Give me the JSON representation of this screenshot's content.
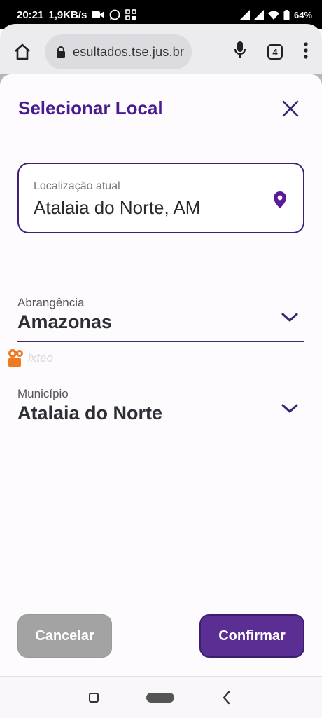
{
  "status_bar": {
    "time": "20:21",
    "speed": "1,9KB/s",
    "battery": "64%"
  },
  "browser": {
    "url": "esultados.tse.jus.br",
    "tab_count": "4",
    "icons": [
      "home-icon",
      "lock-icon",
      "mic-icon",
      "tabs-icon",
      "more-vert-icon"
    ]
  },
  "dialog": {
    "title": "Selecionar Local",
    "current_location": {
      "label": "Localização atual",
      "value": "Atalaia do Norte, AM"
    },
    "scope": {
      "label": "Abrangência",
      "value": "Amazonas"
    },
    "municipality": {
      "label": "Município",
      "value": "Atalaia do Norte"
    },
    "watermark": "ixteo",
    "buttons": {
      "cancel": "Cancelar",
      "confirm": "Confirmar"
    }
  },
  "colors": {
    "primary": "#4a1b8e",
    "confirm_bg": "#5a2e93",
    "cancel_bg": "#a3a3a3",
    "pin": "#5a1a9a"
  }
}
